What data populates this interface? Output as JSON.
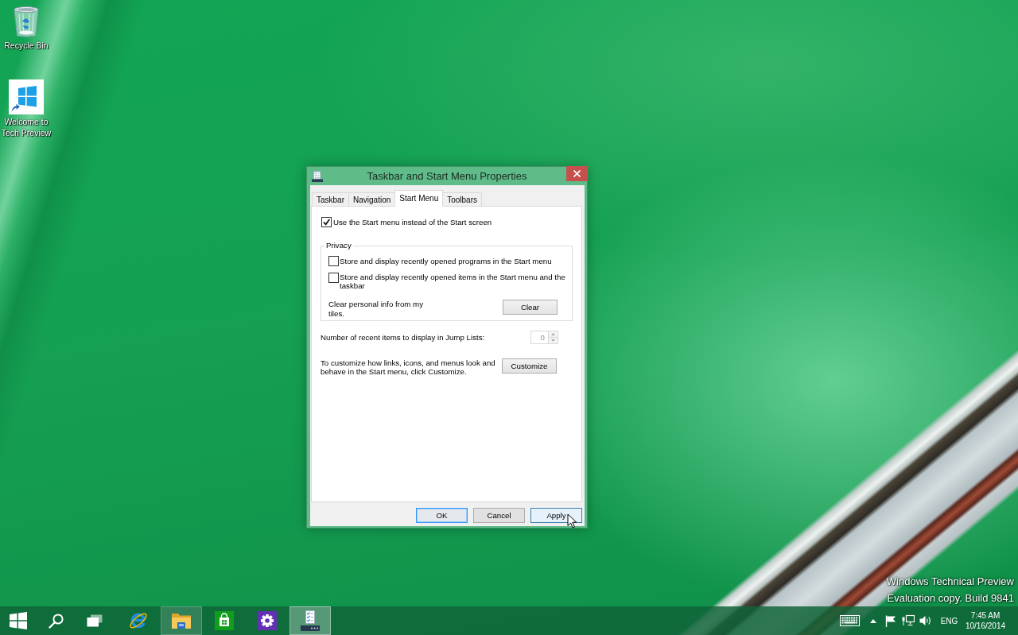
{
  "desktop": {
    "icons": [
      {
        "label": "Recycle Bin"
      },
      {
        "label": "Welcome to Tech Preview"
      }
    ],
    "edition": [
      "Windows Technical Preview",
      "Evaluation copy. Build 9841"
    ]
  },
  "window": {
    "title": "Taskbar and Start Menu Properties",
    "tabs": [
      {
        "label": "Taskbar",
        "selected": false
      },
      {
        "label": "Navigation",
        "selected": false
      },
      {
        "label": "Start Menu",
        "selected": true
      },
      {
        "label": "Toolbars",
        "selected": false
      }
    ],
    "start_menu_option": {
      "label": "Use the Start menu instead of the Start screen",
      "checked": true
    },
    "privacy": {
      "title": "Privacy",
      "options": [
        {
          "label": "Store and display recently opened programs in the Start menu",
          "checked": false
        },
        {
          "label": "Store and display recently opened items in the Start menu and the taskbar",
          "checked": false
        }
      ],
      "clear_text": "Clear personal info from my tiles.",
      "clear_button": "Clear"
    },
    "jump_lists": {
      "label": "Number of recent items to display in Jump Lists:",
      "value": "0",
      "disabled": true
    },
    "customize": {
      "text": "To customize how links, icons, and menus look and behave in the Start menu, click Customize.",
      "button": "Customize"
    },
    "buttons": [
      {
        "label": "OK",
        "default": true,
        "hovered": false
      },
      {
        "label": "Cancel",
        "default": false,
        "hovered": false
      },
      {
        "label": "Apply",
        "default": false,
        "hovered": true
      }
    ]
  },
  "taskbar": {
    "apps": [
      {
        "running": false,
        "active": false
      },
      {
        "running": true,
        "active": false
      },
      {
        "running": false,
        "active": false
      },
      {
        "running": false,
        "active": false
      },
      {
        "running": true,
        "active": true
      }
    ],
    "tray": {
      "language": "ENG",
      "time": "7:45 AM",
      "date": "10/16/2014"
    }
  }
}
